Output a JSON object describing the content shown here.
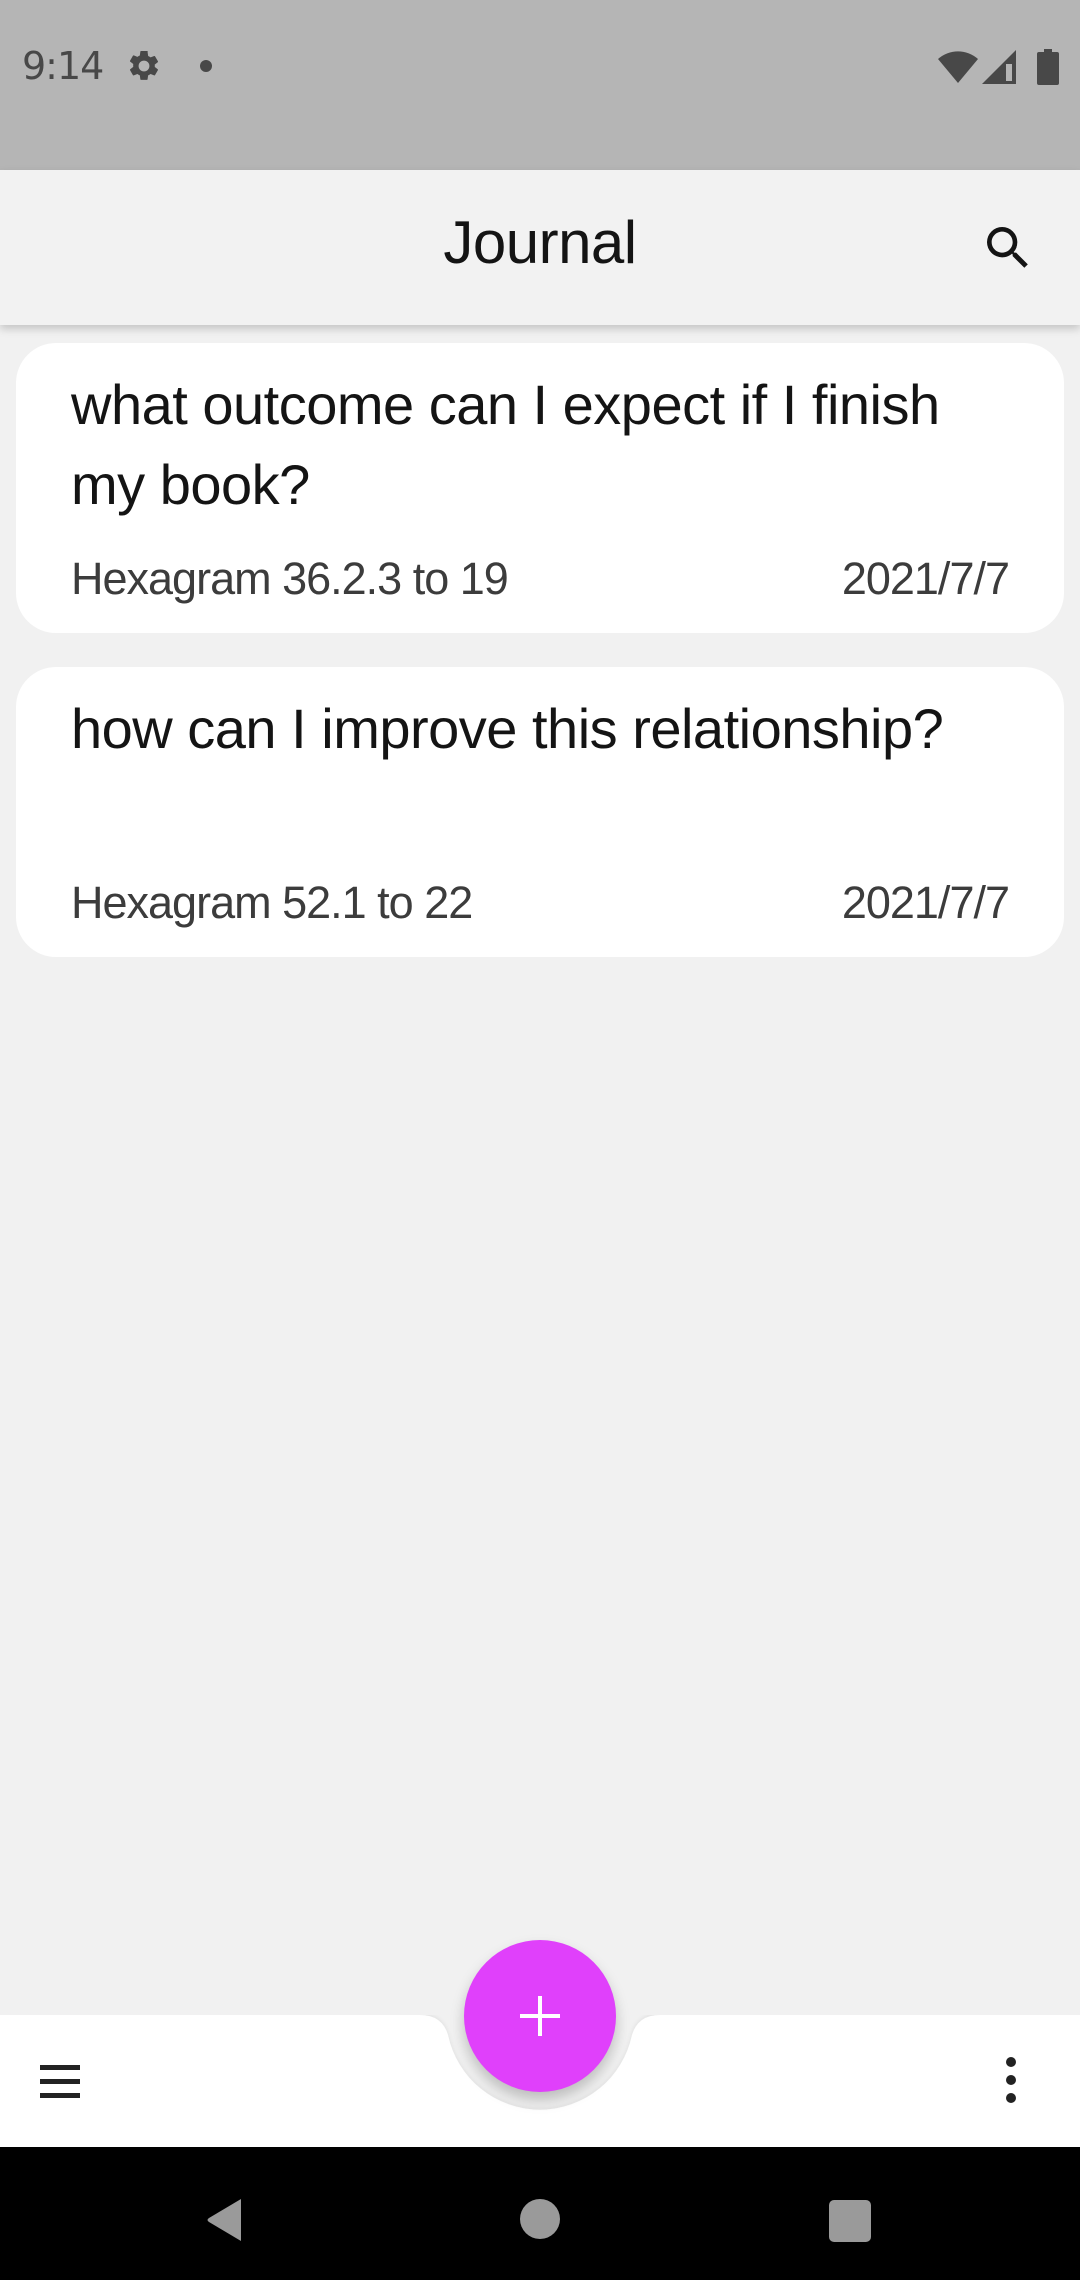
{
  "status_bar": {
    "time": "9:14",
    "icons": [
      "gear-icon",
      "notification-dot-icon",
      "wifi-icon",
      "cellular-signal-icon",
      "battery-icon"
    ]
  },
  "app_bar": {
    "title": "Journal",
    "actions": [
      {
        "icon": "search-icon",
        "label": "Search"
      }
    ]
  },
  "entries": [
    {
      "question": "what outcome can I expect if I finish my book?",
      "hexagram": "Hexagram 36.2.3 to 19",
      "date": "2021/7/7"
    },
    {
      "question": "how can I improve this relationship?",
      "hexagram": "Hexagram 52.1 to 22",
      "date": "2021/7/7"
    }
  ],
  "bottom_bar": {
    "left_icon": "menu-icon",
    "right_icon": "more-vert-icon",
    "fab": {
      "icon": "plus-icon",
      "label": "Add entry",
      "color": "#e040fb"
    }
  },
  "nav_bar": {
    "buttons": [
      "back",
      "home",
      "recents"
    ]
  },
  "colors": {
    "accent": "#e040fb",
    "background": "#f1f1f1",
    "card": "#ffffff",
    "status_bar": "#b5b5b5"
  }
}
